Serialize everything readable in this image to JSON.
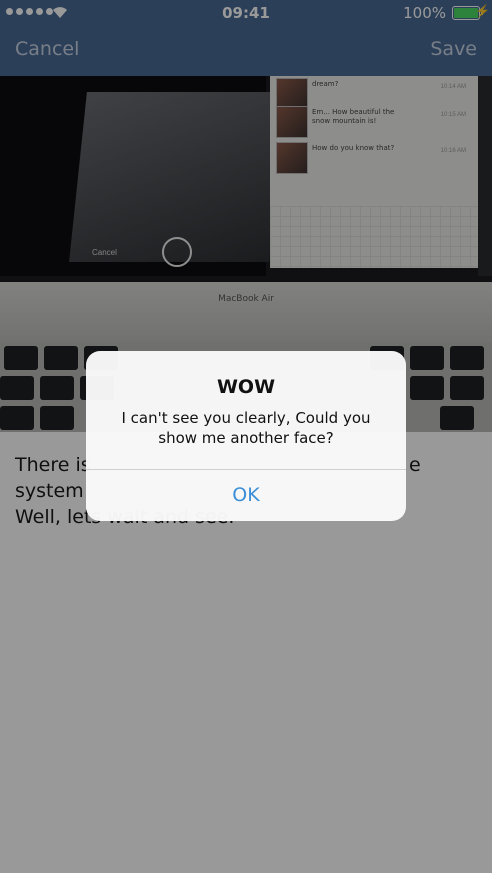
{
  "status_bar": {
    "time": "09:41",
    "battery_percent": "100%",
    "signal_dots": 5,
    "battery_level": 1.0
  },
  "nav": {
    "cancel_label": "Cancel",
    "save_label": "Save"
  },
  "photo": {
    "chat_messages": [
      {
        "text": "dream?",
        "time": "10:14 AM"
      },
      {
        "text": "Em... How beautiful the snow mountain is!",
        "time": "10:15 AM"
      },
      {
        "text": "How do you know that?",
        "time": "10:16 AM"
      }
    ],
    "camera_cancel": "Cancel",
    "laptop_brand": "MacBook Air"
  },
  "body_text": {
    "line1": "There is",
    "line1_end": "e",
    "line2": "system",
    "line3": "Well, lets wait and see."
  },
  "alert": {
    "title": "WOW",
    "message": "I can't see you clearly, Could you show me another face?",
    "ok_label": "OK"
  },
  "colors": {
    "nav_background": "#4a6a94",
    "alert_button": "#3a8fd8",
    "battery_fill": "#4cd964"
  }
}
